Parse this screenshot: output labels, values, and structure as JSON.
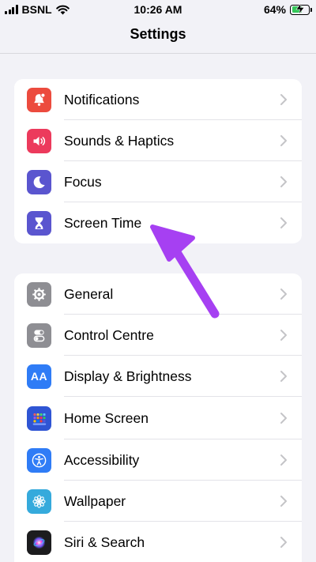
{
  "status_bar": {
    "carrier": "BSNL",
    "time": "10:26 AM",
    "battery": "64%",
    "battery_level": 0.64,
    "icons": [
      "signal-icon",
      "wifi-icon",
      "battery-icon"
    ]
  },
  "nav": {
    "title": "Settings"
  },
  "groups": [
    {
      "items": [
        {
          "label": "Notifications",
          "icon": "bell-icon",
          "color": "#ec4b3e"
        },
        {
          "label": "Sounds & Haptics",
          "icon": "speaker-icon",
          "color": "#ec3a5c"
        },
        {
          "label": "Focus",
          "icon": "moon-icon",
          "color": "#5a55cf"
        },
        {
          "label": "Screen Time",
          "icon": "hourglass-icon",
          "color": "#5a55cf"
        }
      ]
    },
    {
      "items": [
        {
          "label": "General",
          "icon": "gear-icon",
          "color": "#8e8e93"
        },
        {
          "label": "Control Centre",
          "icon": "toggles-icon",
          "color": "#8e8e93"
        },
        {
          "label": "Display & Brightness",
          "icon": "text-size-icon",
          "color": "#2f7cf6"
        },
        {
          "label": "Home Screen",
          "icon": "app-grid-icon",
          "color": "#2f55d4"
        },
        {
          "label": "Accessibility",
          "icon": "accessibility-icon",
          "color": "#2f7cf6"
        },
        {
          "label": "Wallpaper",
          "icon": "flower-icon",
          "color": "#35aadc"
        },
        {
          "label": "Siri & Search",
          "icon": "siri-icon",
          "color": "#1c1c1e"
        }
      ]
    }
  ],
  "annotation": {
    "icon": "pointer-arrow-icon",
    "color": "#a640f2",
    "target": "Screen Time"
  },
  "display_brightness_glyph": "AA"
}
